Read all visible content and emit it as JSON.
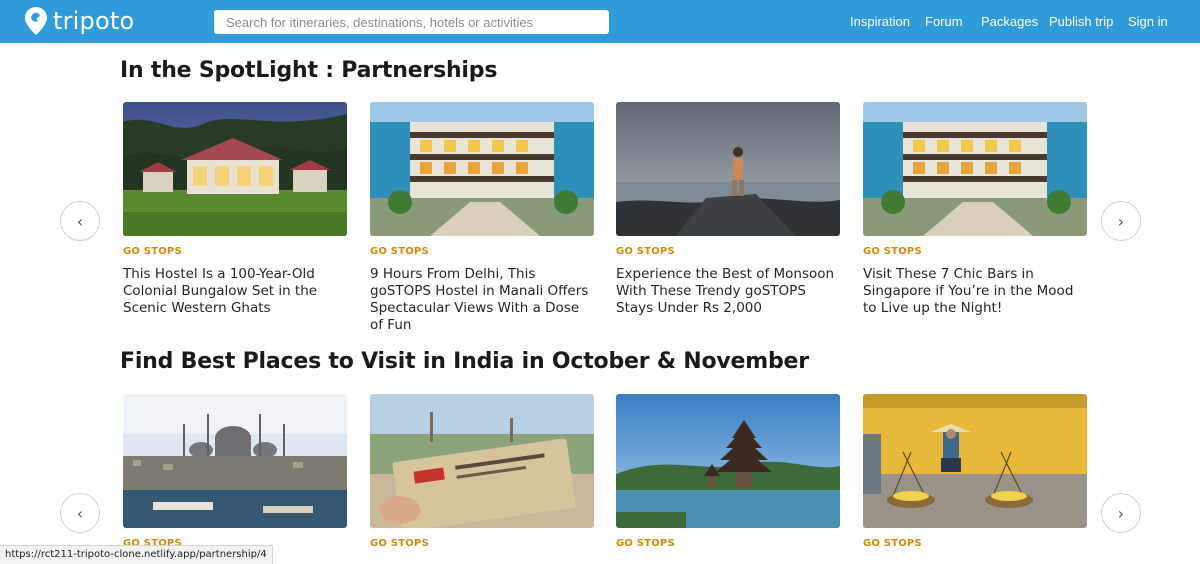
{
  "header": {
    "logo_text": "tripoto",
    "search_placeholder": "Search for itineraries, destinations, hotels or activities",
    "nav": [
      "Inspiration",
      "Forum",
      "Packages",
      "Publish trip",
      "Sign in"
    ]
  },
  "sections": [
    {
      "title": "In the SpotLight : Partnerships",
      "cards": [
        {
          "tag": "GO STOPS",
          "title": "This Hostel Is a 100-Year-Old Colonial Bungalow Set in the Scenic Western Ghats",
          "image": "colonial-bungalow-at-dusk"
        },
        {
          "tag": "GO STOPS",
          "title": "9 Hours From Delhi, This goSTOPS Hostel in Manali Offers Spectacular Views With a Dose of Fun",
          "image": "colorful-hostel-courtyard"
        },
        {
          "tag": "GO STOPS",
          "title": "Experience the Best of Monsoon With These Trendy goSTOPS Stays Under Rs 2,000",
          "image": "man-on-rocks-by-sea"
        },
        {
          "tag": "GO STOPS",
          "title": "Visit These 7 Chic Bars in Singapore if You’re in the Mood to Live up the Night!",
          "image": "colorful-hostel-courtyard"
        }
      ]
    },
    {
      "title": "Find Best Places to Visit in India in October & November",
      "cards": [
        {
          "tag": "GO STOPS",
          "title": "",
          "image": "mosque-skyline-over-water"
        },
        {
          "tag": "GO STOPS",
          "title": "",
          "image": "hand-holding-ticket"
        },
        {
          "tag": "GO STOPS",
          "title": "",
          "image": "pagoda-temple-on-lake"
        },
        {
          "tag": "GO STOPS",
          "title": "",
          "image": "street-vendor-yellow-wall"
        }
      ]
    }
  ],
  "status_url": "https://rct211-tripoto-clone.netlify.app/partnership/4",
  "colors": {
    "header": "#2f9bdb",
    "tag": "#cf8a12"
  }
}
